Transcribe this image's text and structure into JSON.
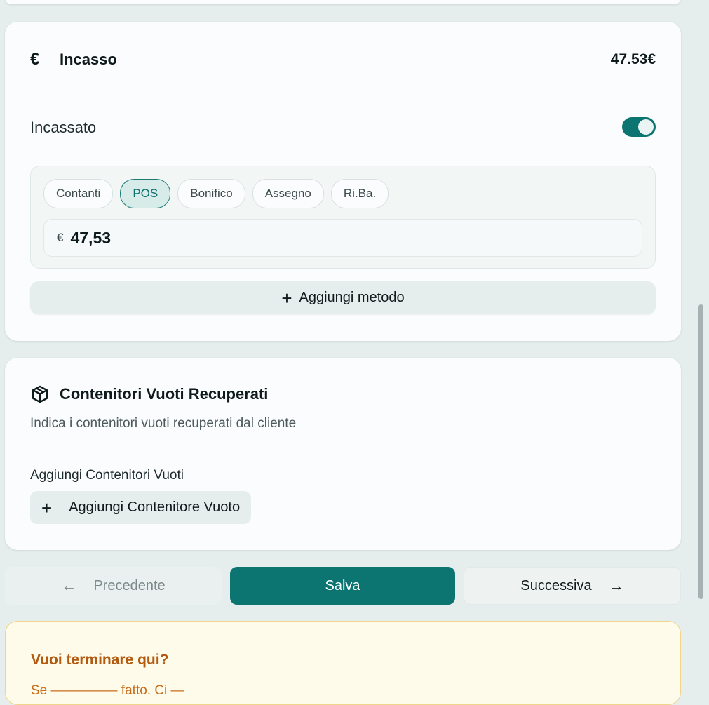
{
  "incasso": {
    "title": "Incasso",
    "euro_symbol": "€",
    "total": "47.53€",
    "incassato_label": "Incassato",
    "toggle_on": true,
    "methods": [
      "Contanti",
      "POS",
      "Bonifico",
      "Assegno",
      "Ri.Ba."
    ],
    "selected_method": "POS",
    "amount_prefix": "€",
    "amount_value": "47,53",
    "add_method_plus": "+",
    "add_method_label": "Aggiungi metodo"
  },
  "contenitori": {
    "title": "Contenitori Vuoti Recuperati",
    "description": "Indica i contenitori vuoti recuperati dal cliente",
    "subheading": "Aggiungi Contenitori Vuoti",
    "add_plus": "+",
    "add_button_label": "Aggiungi Contenitore Vuoto"
  },
  "navigation": {
    "prev_arrow": "←",
    "prev_label": "Precedente",
    "save_label": "Salva",
    "next_label": "Successiva",
    "next_arrow": "→"
  },
  "warning": {
    "title": "Vuoi terminare qui?",
    "text": "Se ————— fatto. Ci —"
  },
  "colors": {
    "accent": "#0c7572",
    "background": "#e6eeed",
    "warning_title": "#b25a0f",
    "warning_bg": "#fffbea"
  },
  "icons": {
    "euro": "euro-icon",
    "box": "box-icon",
    "plus": "plus-icon",
    "arrow_left": "arrow-left-icon",
    "arrow_right": "arrow-right-icon"
  }
}
